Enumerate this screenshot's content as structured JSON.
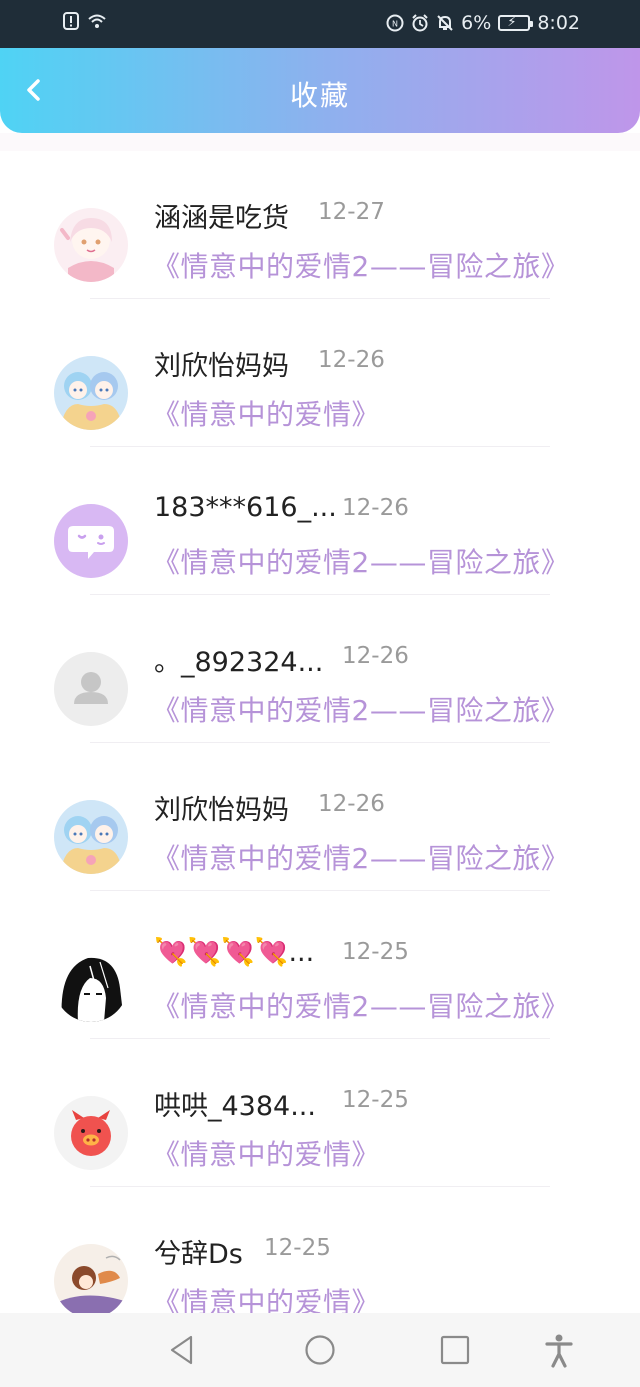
{
  "status_bar": {
    "battery_percent": "6%",
    "time": "8:02",
    "icons": [
      "alert-icon",
      "wifi-icon",
      "nfc-icon",
      "alarm-icon",
      "mute-icon",
      "battery-charging-icon"
    ]
  },
  "header": {
    "title": "收藏",
    "back_icon": "chevron-left-icon",
    "gradient": [
      "#4fd3f4",
      "#bf96ea"
    ]
  },
  "colors": {
    "work_title": "#b693d8",
    "name": "#222222",
    "date": "#9a9a9a"
  },
  "favorites": [
    {
      "name": "涵涵是吃货",
      "date": "12-27",
      "work": "《情意中的爱情2——冒险之旅》",
      "avatar": "anime-girl-pink-avatar"
    },
    {
      "name": "刘欣怡妈妈",
      "date": "12-26",
      "work": "《情意中的爱情》",
      "avatar": "anime-twins-avatar"
    },
    {
      "name": "183***616_...",
      "date": "12-26",
      "work": "《情意中的爱情2——冒险之旅》",
      "avatar": "chat-bubble-avatar"
    },
    {
      "name": "。_892324...",
      "date": "12-26",
      "work": "《情意中的爱情2——冒险之旅》",
      "avatar": "default-user-avatar"
    },
    {
      "name": "刘欣怡妈妈",
      "date": "12-26",
      "work": "《情意中的爱情2——冒险之旅》",
      "avatar": "anime-twins-avatar"
    },
    {
      "name": "💘💘💘💘...",
      "date": "12-25",
      "work": "《情意中的爱情2——冒险之旅》",
      "avatar": "manga-girl-avatar"
    },
    {
      "name": "哄哄_4384...",
      "date": "12-25",
      "work": "《情意中的爱情》",
      "avatar": "pig-avatar"
    },
    {
      "name": "兮辞Ds",
      "date": "12-25",
      "work": "《情意中的爱情》",
      "avatar": "anime-fox-girl-avatar"
    }
  ],
  "nav_bar": {
    "buttons": [
      "back-triangle-icon",
      "home-circle-icon",
      "recents-square-icon",
      "accessibility-icon"
    ]
  }
}
